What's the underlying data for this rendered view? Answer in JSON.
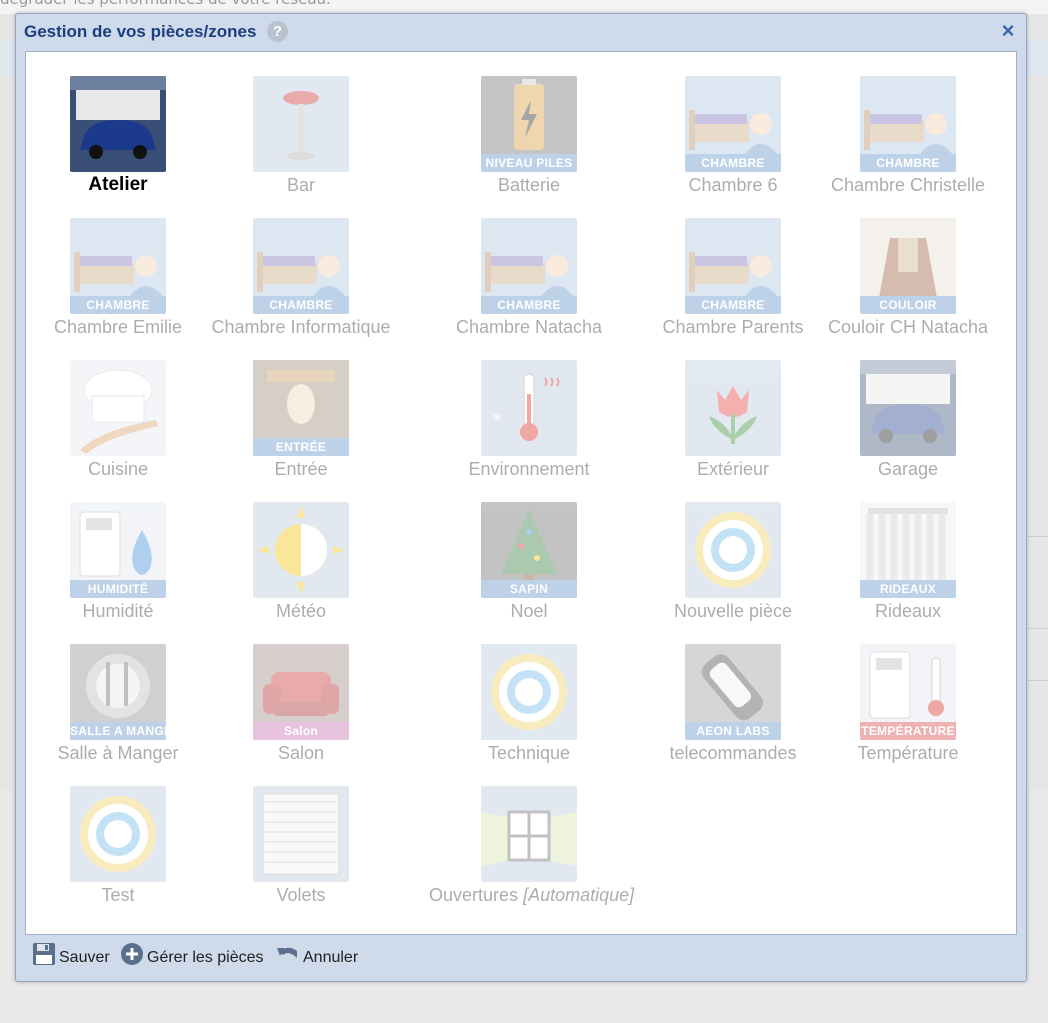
{
  "background": {
    "top_text": "dégrader les performances de votre réseau."
  },
  "dialog": {
    "title": "Gestion de vos pièces/zones",
    "help": "?",
    "close": "×"
  },
  "rooms": [
    {
      "label": "Atelier",
      "banner": "",
      "icon": "garage-car-icon",
      "color": "#3a4f76",
      "selected": true
    },
    {
      "label": "Bar",
      "banner": "",
      "icon": "bar-stool-icon",
      "color": "#b8c8dc"
    },
    {
      "label": "Batterie",
      "banner": "NIVEAU PILES",
      "icon": "battery-icon",
      "color": "#6f6f6f"
    },
    {
      "label": "Chambre 6",
      "banner": "CHAMBRE",
      "icon": "bed-person-icon",
      "color": "#aac4e0"
    },
    {
      "label": "Chambre Christelle",
      "banner": "CHAMBRE",
      "icon": "bed-person-icon",
      "color": "#aac4e0"
    },
    {
      "label": "Chambre Emilie",
      "banner": "CHAMBRE",
      "icon": "bed-person-icon",
      "color": "#aac4e0"
    },
    {
      "label": "Chambre Informatique",
      "banner": "CHAMBRE",
      "icon": "bed-person-icon",
      "color": "#aac4e0"
    },
    {
      "label": "Chambre Natacha",
      "banner": "CHAMBRE",
      "icon": "bed-person-icon",
      "color": "#aac4e0"
    },
    {
      "label": "Chambre Parents",
      "banner": "CHAMBRE",
      "icon": "bed-person-icon",
      "color": "#aac4e0"
    },
    {
      "label": "Couloir CH Natacha",
      "banner": "COULOIR",
      "icon": "corridor-icon",
      "color": "#c8b8a8"
    },
    {
      "label": "Cuisine",
      "banner": "",
      "icon": "chef-hat-icon",
      "color": "#e4e8ee"
    },
    {
      "label": "Entrée",
      "banner": "ENTRÉE",
      "icon": "door-handle-icon",
      "color": "#8b7b6b"
    },
    {
      "label": "Environnement",
      "banner": "",
      "icon": "thermometer-icon",
      "color": "#b8c8dc"
    },
    {
      "label": "Extérieur",
      "banner": "",
      "icon": "tulip-icon",
      "color": "#b8c8dc"
    },
    {
      "label": "Garage",
      "banner": "",
      "icon": "garage-car-icon",
      "color": "#3a4f76"
    },
    {
      "label": "Humidité",
      "banner": "HUMIDITÉ",
      "icon": "humidity-sensor-icon",
      "color": "#dfe6ef"
    },
    {
      "label": "Météo",
      "banner": "",
      "icon": "sun-moon-icon",
      "color": "#b8c8dc"
    },
    {
      "label": "Noel",
      "banner": "SAPIN",
      "icon": "christmas-tree-icon",
      "color": "#6b6b6b"
    },
    {
      "label": "Nouvelle pièce",
      "banner": "",
      "icon": "target-ring-icon",
      "color": "#b8c8dc"
    },
    {
      "label": "Rideaux",
      "banner": "RIDEAUX",
      "icon": "curtains-icon",
      "color": "#c8ccd2"
    },
    {
      "label": "Salle à Manger",
      "banner": "SALLE A MANGER",
      "icon": "plate-cutlery-icon",
      "color": "#8b8b8b"
    },
    {
      "label": "Salon",
      "banner": "Salon",
      "icon": "armchair-icon",
      "color": "#9a8a86"
    },
    {
      "label": "Technique",
      "banner": "",
      "icon": "target-ring-icon",
      "color": "#b8c8dc"
    },
    {
      "label": "telecommandes",
      "banner": "AEON LABS",
      "icon": "remote-control-icon",
      "color": "#9a9a9a"
    },
    {
      "label": "Température",
      "banner": "TEMPÉRATURE",
      "icon": "temperature-sensor-icon",
      "color": "#dfe6ef"
    },
    {
      "label": "Test",
      "banner": "",
      "icon": "target-ring-icon",
      "color": "#b8c8dc"
    },
    {
      "label": "Volets",
      "banner": "",
      "icon": "shutter-icon",
      "color": "#b8c8dc"
    },
    {
      "label": "Ouvertures",
      "label_suffix": "[Automatique]",
      "banner": "",
      "icon": "window-icon",
      "color": "#b8c8dc"
    }
  ],
  "footer": {
    "save": "Sauver",
    "manage": "Gérer les pièces",
    "cancel": "Annuler"
  }
}
